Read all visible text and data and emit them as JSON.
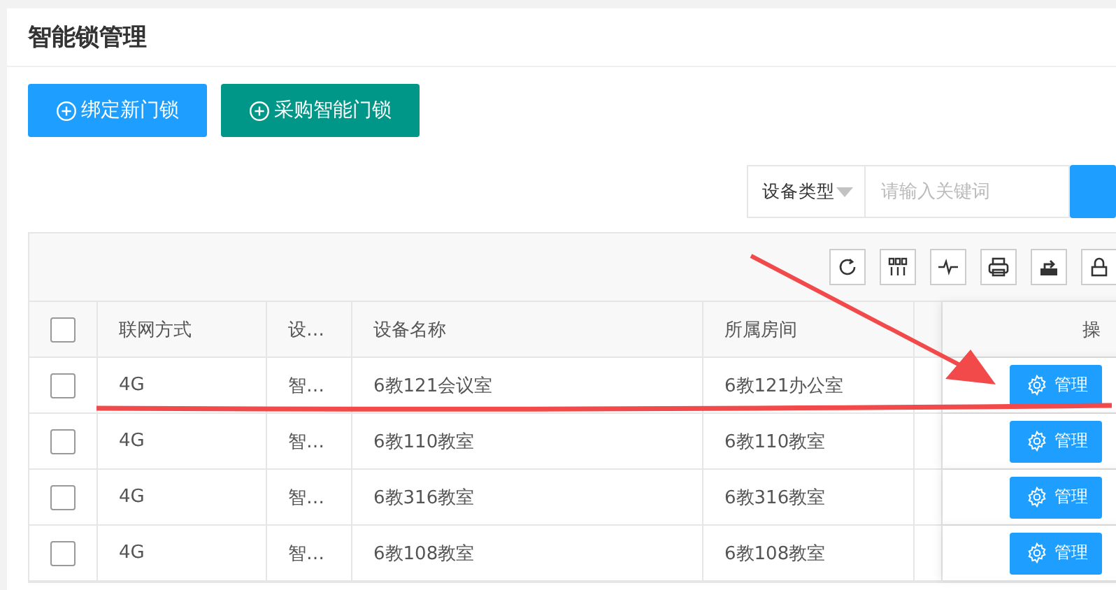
{
  "page": {
    "title": "智能锁管理"
  },
  "actions": [
    {
      "label": "绑定新门锁",
      "kind": "primary"
    },
    {
      "label": "采购智能门锁",
      "kind": "teal"
    }
  ],
  "search": {
    "select_label": "设备类型",
    "placeholder": "请输入关键词"
  },
  "table": {
    "all_checked": false,
    "columns": [
      {
        "label": "联网方式"
      },
      {
        "label": "设…"
      },
      {
        "label": "设备名称"
      },
      {
        "label": "所属房间"
      },
      {
        "label": "操"
      }
    ],
    "rows": [
      {
        "checked": false,
        "cells": [
          "4G",
          "智…",
          "6教121会议室",
          "6教121办公室"
        ],
        "action": "管理"
      },
      {
        "checked": false,
        "cells": [
          "4G",
          "智…",
          "6教110教室",
          "6教110教室"
        ],
        "action": "管理"
      },
      {
        "checked": false,
        "cells": [
          "4G",
          "智…",
          "6教316教室",
          "6教316教室"
        ],
        "action": "管理"
      },
      {
        "checked": false,
        "cells": [
          "4G",
          "智…",
          "6教108教室",
          "6教108教室"
        ],
        "action": "管理"
      }
    ]
  }
}
